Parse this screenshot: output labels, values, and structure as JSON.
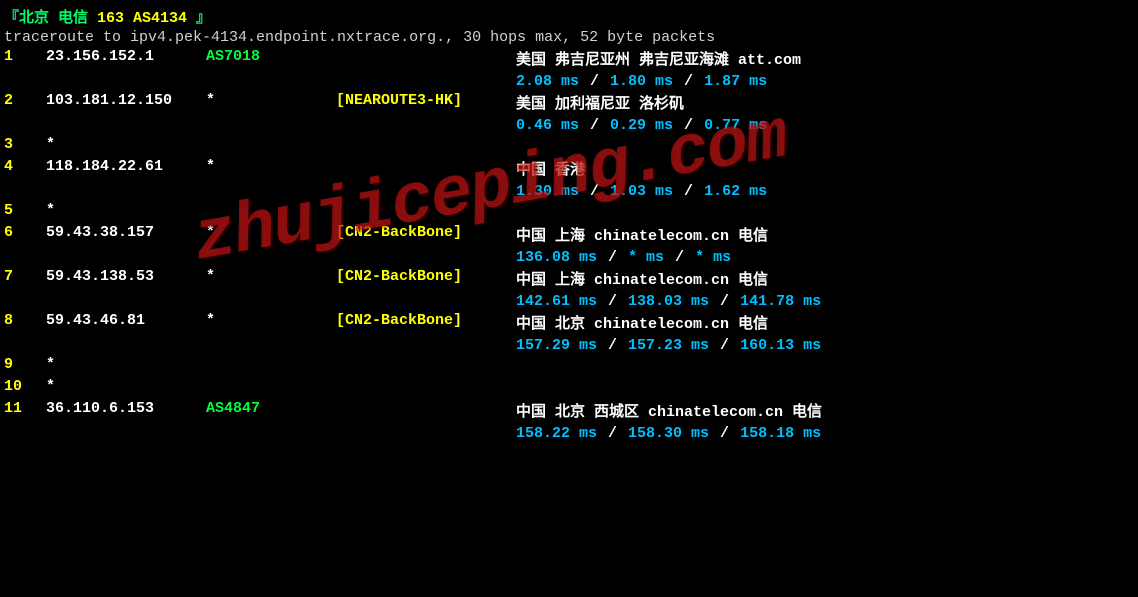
{
  "watermark": "zhujiceping.com",
  "header": {
    "prefix": "『北京 电信 ",
    "isp_tag": "163 AS4134",
    "suffix": " 』",
    "line2": "traceroute to ipv4.pek-4134.endpoint.nxtrace.org., 30 hops max, 52 byte packets"
  },
  "hops": [
    {
      "n": "1",
      "ip": "23.156.152.1",
      "asn": "AS7018",
      "asn_style": "green",
      "tag": "",
      "loc": "美国 弗吉尼亚州 弗吉尼亚海滩  att.com",
      "rtt": [
        "2.08 ms",
        "1.80 ms",
        "1.87 ms"
      ]
    },
    {
      "n": "2",
      "ip": "103.181.12.150",
      "asn": "*",
      "asn_style": "white",
      "tag": "[NEAROUTE3-HK]",
      "loc": "美国 加利福尼亚 洛杉矶",
      "rtt": [
        "0.46 ms",
        "0.29 ms",
        "0.77 ms"
      ]
    },
    {
      "n": "3",
      "ip": "*",
      "asn": "",
      "asn_style": "white",
      "tag": "",
      "loc": "",
      "rtt": null
    },
    {
      "n": "4",
      "ip": "118.184.22.61",
      "asn": "*",
      "asn_style": "white",
      "tag": "",
      "loc": "中国 香港",
      "rtt": [
        "1.30 ms",
        "1.03 ms",
        "1.62 ms"
      ]
    },
    {
      "n": "5",
      "ip": "*",
      "asn": "",
      "asn_style": "white",
      "tag": "",
      "loc": "",
      "rtt": null
    },
    {
      "n": "6",
      "ip": "59.43.38.157",
      "asn": "*",
      "asn_style": "white",
      "tag": "[CN2-BackBone]",
      "loc": "中国 上海   chinatelecom.cn  电信",
      "rtt": [
        "136.08 ms",
        "* ms",
        "* ms"
      ]
    },
    {
      "n": "7",
      "ip": "59.43.138.53",
      "asn": "*",
      "asn_style": "white",
      "tag": "[CN2-BackBone]",
      "loc": "中国 上海   chinatelecom.cn  电信",
      "rtt": [
        "142.61 ms",
        "138.03 ms",
        "141.78 ms"
      ]
    },
    {
      "n": "8",
      "ip": "59.43.46.81",
      "asn": "*",
      "asn_style": "white",
      "tag": "[CN2-BackBone]",
      "loc": "中国 北京   chinatelecom.cn  电信",
      "rtt": [
        "157.29 ms",
        "157.23 ms",
        "160.13 ms"
      ]
    },
    {
      "n": "9",
      "ip": "*",
      "asn": "",
      "asn_style": "white",
      "tag": "",
      "loc": "",
      "rtt": null
    },
    {
      "n": "10",
      "ip": "*",
      "asn": "",
      "asn_style": "white",
      "tag": "",
      "loc": "",
      "rtt": null
    },
    {
      "n": "11",
      "ip": "36.110.6.153",
      "asn": "AS4847",
      "asn_style": "green",
      "tag": "",
      "loc": "中国 北京   西城区 chinatelecom.cn  电信",
      "rtt": [
        "158.22 ms",
        "158.30 ms",
        "158.18 ms"
      ]
    }
  ]
}
